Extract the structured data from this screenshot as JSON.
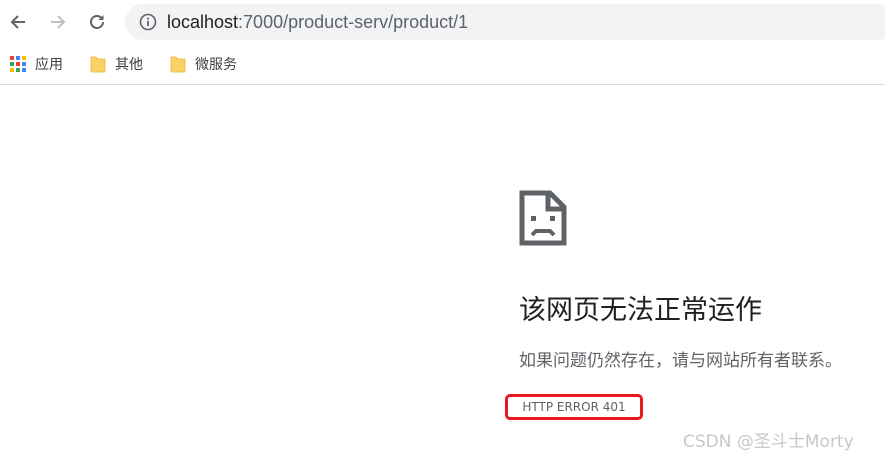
{
  "browser": {
    "url_host": "localhost",
    "url_rest": ":7000/product-serv/product/1",
    "bookmarks": [
      {
        "label": "应用",
        "icon": "apps-grid-icon"
      },
      {
        "label": "其他",
        "icon": "folder-icon"
      },
      {
        "label": "微服务",
        "icon": "folder-icon"
      }
    ]
  },
  "error": {
    "title": "该网页无法正常运作",
    "description": "如果问题仍然存在，请与网站所有者联系。",
    "code": "HTTP ERROR 401",
    "highlight_color": "#e8191d"
  },
  "watermark": "CSDN @圣斗士Morty"
}
